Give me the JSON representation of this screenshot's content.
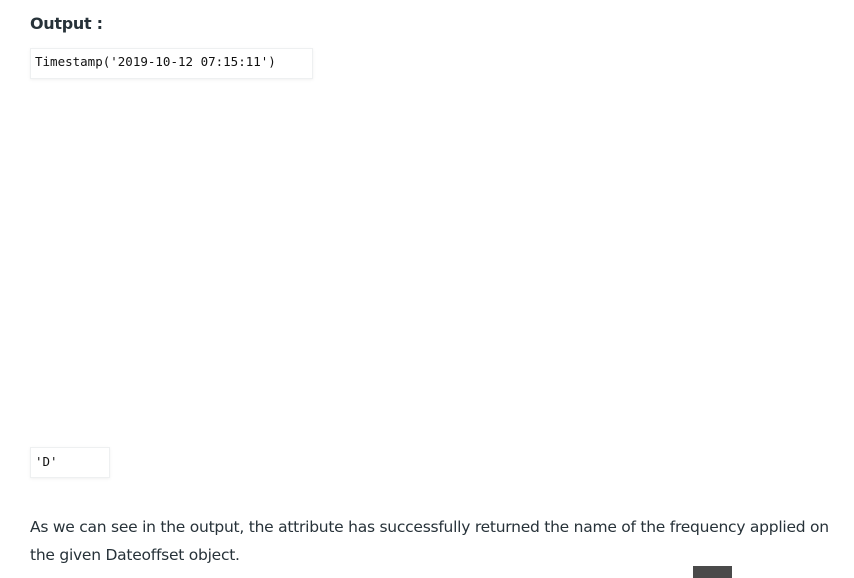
{
  "article": {
    "output_heading": "Output :",
    "code_outputs": [
      "Timestamp('2019-10-12 07:15:11')",
      "'D'"
    ],
    "paragraph": "As we can see in the output, the attribute has successfully returned the name of the frequency applied on the given Dateoffset object."
  },
  "colors": {
    "text": "#273239",
    "code_text": "#111111",
    "code_border": "#eef0f1",
    "corner_block": "#4a4a4a"
  }
}
